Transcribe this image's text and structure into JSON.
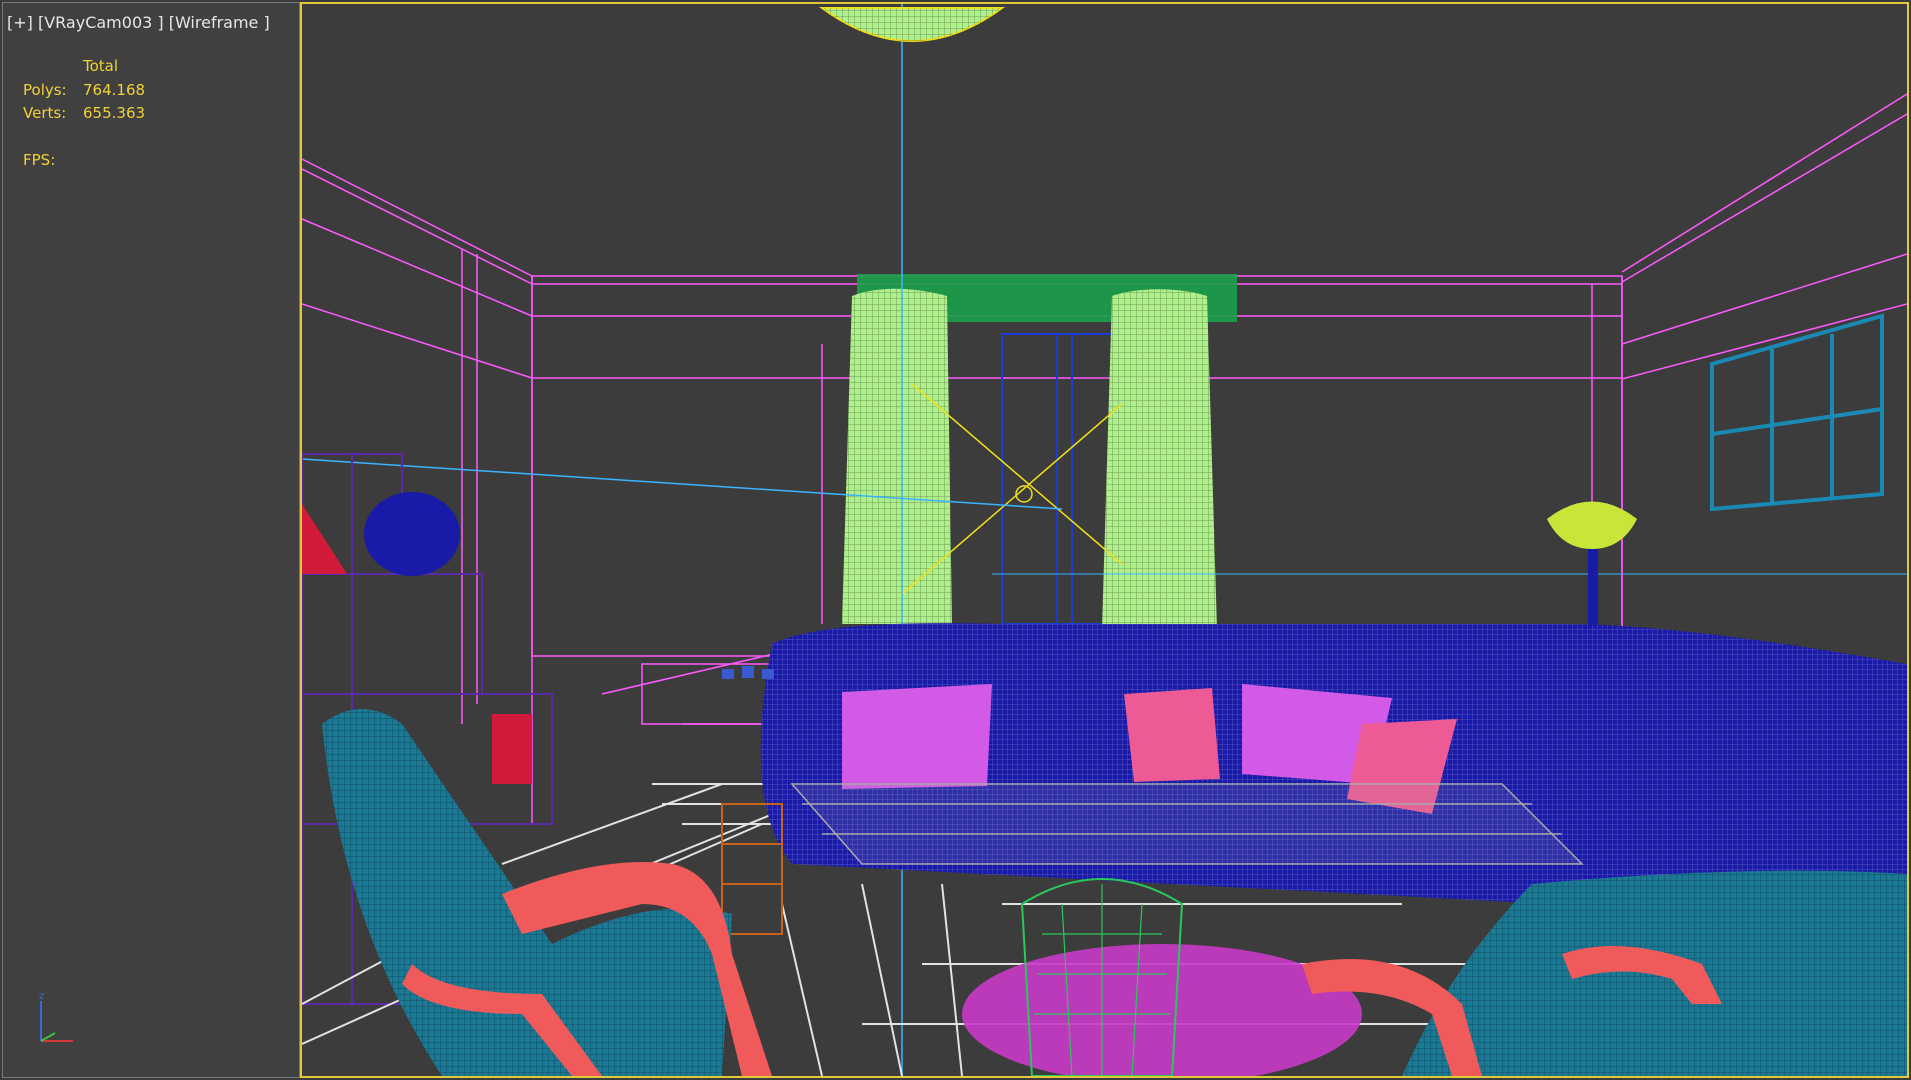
{
  "viewport_left": {
    "label": "[+] [VRayCam003 ] [Wireframe ]",
    "stats": {
      "header": "Total",
      "polys_label": "Polys:",
      "polys_value": "764.168",
      "verts_label": "Verts:",
      "verts_value": "655.363",
      "fps_label": "FPS:"
    },
    "axis_gizmo": {
      "z_label": "z",
      "colors": {
        "x": "#d23a3a",
        "y": "#3ac33a",
        "z": "#3a6ad2"
      }
    }
  },
  "viewport_main": {
    "mode": "wireframe",
    "border_color": "#e2c93a",
    "scene_colors": {
      "room_lines": "#ff5aff",
      "curtains": "#aef08a",
      "sofa": "#1a1aa8",
      "pillows_violet": "#d25ae6",
      "pillows_pink": "#ee5a96",
      "armchair": "#1a7a96",
      "armchair_frame": "#f05a5a",
      "floor_tiles": "#ffffff",
      "window_right": "#1a8ab4",
      "lamp_shade": "#c8e63a",
      "shelf": "#5a2aa8",
      "rug": "#c83ac8",
      "basket": "#2ac85a",
      "side_table": "#c8641a"
    }
  }
}
